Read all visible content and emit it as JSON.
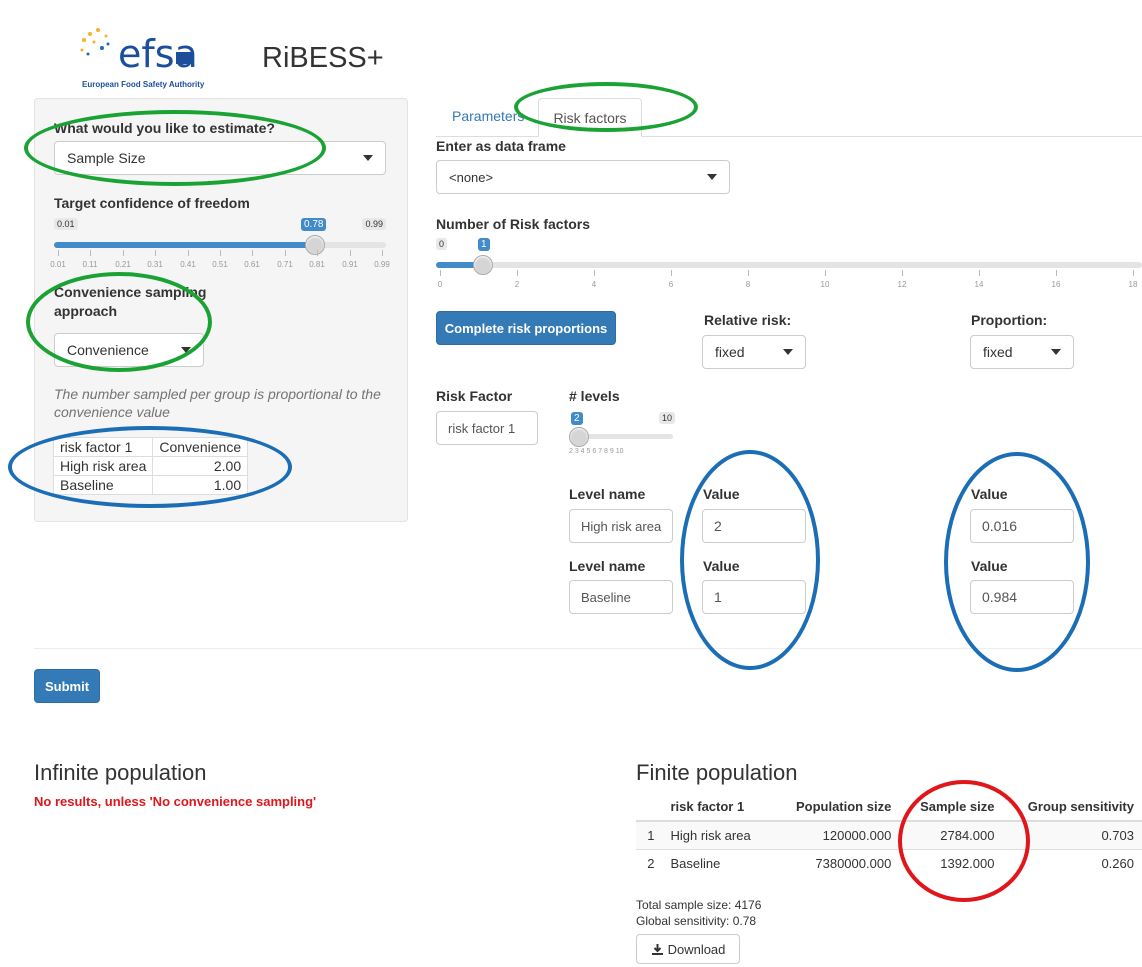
{
  "header": {
    "logo_text": "efsa",
    "logo_subtitle": "European Food Safety Authority",
    "app_title": "RiBESS+"
  },
  "sidebar": {
    "estimate_label": "What would you like to estimate?",
    "estimate_value": "Sample Size",
    "confidence_label": "Target confidence of freedom",
    "confidence": {
      "min": "0.01",
      "max": "0.99",
      "value": "0.78",
      "fraction": 0.78,
      "ticks": [
        "0.01",
        "0.11",
        "0.21",
        "0.31",
        "0.41",
        "0.51",
        "0.61",
        "0.71",
        "0.81",
        "0.91",
        "0.99"
      ]
    },
    "convenience_label": "Convenience sampling approach",
    "convenience_value": "Convenience",
    "help_text": "The number sampled per group is proportional to the convenience value",
    "table": {
      "headers": [
        "risk factor 1",
        "Convenience"
      ],
      "rows": [
        [
          "High risk area",
          "2.00"
        ],
        [
          "Baseline",
          "1.00"
        ]
      ]
    }
  },
  "tabs": [
    {
      "label": "Parameters",
      "active": false
    },
    {
      "label": "Risk factors",
      "active": true
    }
  ],
  "risk_tab": {
    "data_frame_label": "Enter as data frame",
    "data_frame_value": "<none>",
    "num_rf_label": "Number of Risk factors",
    "num_rf": {
      "min": "0",
      "value": "1",
      "ticks": [
        "0",
        "2",
        "4",
        "6",
        "8",
        "10",
        "12",
        "14",
        "16",
        "18"
      ]
    },
    "complete_button": "Complete risk proportions",
    "relative_risk_label": "Relative risk:",
    "relative_risk_value": "fixed",
    "proportion_label": "Proportion:",
    "proportion_value": "fixed",
    "risk_factor_label": "Risk Factor",
    "risk_factor_value": "risk factor 1",
    "levels_label": "# levels",
    "levels": {
      "value": "2",
      "max": "10",
      "ticks": "2 3 4 5 6 7 8 9 10"
    },
    "level_rows": [
      {
        "name_label": "Level name",
        "name": "High risk area",
        "value_label": "Value",
        "rr": "2",
        "prop_label": "Value",
        "prop": "0.016"
      },
      {
        "name_label": "Level name",
        "name": "Baseline",
        "value_label": "Value",
        "rr": "1",
        "prop_label": "Value",
        "prop": "0.984"
      }
    ]
  },
  "submit_label": "Submit",
  "infinite": {
    "title": "Infinite population",
    "message": "No results, unless 'No convenience sampling'"
  },
  "finite": {
    "title": "Finite population",
    "headers": [
      "",
      "risk factor 1",
      "Population size",
      "Sample size",
      "Group sensitivity"
    ],
    "rows": [
      [
        "1",
        "High risk area",
        "120000.000",
        "2784.000",
        "0.703"
      ],
      [
        "2",
        "Baseline",
        "7380000.000",
        "1392.000",
        "0.260"
      ]
    ],
    "total": "Total sample size: 4176",
    "global": "Global sensitivity: 0.78",
    "download_label": "Download"
  },
  "colors": {
    "primary": "#337ab7",
    "annotation_green": "#1aa334",
    "annotation_blue": "#1b6eb5",
    "annotation_red": "#e0161b",
    "warning_text": "#e0161b"
  }
}
